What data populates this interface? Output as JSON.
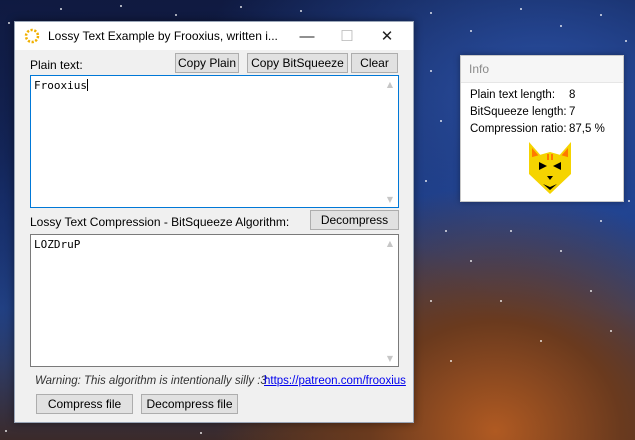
{
  "window": {
    "title": "Lossy Text Example by Frooxius, written i...",
    "minimize_glyph": "—",
    "maximize_glyph": "☐",
    "close_glyph": "✕"
  },
  "plain": {
    "label": "Plain text:",
    "copy_plain": "Copy Plain",
    "copy_bitsqueeze": "Copy BitSqueeze",
    "clear": "Clear",
    "value": "Frooxius"
  },
  "bitsqueeze": {
    "label": "Lossy Text Compression - BitSqueeze Algorithm:",
    "decompress": "Decompress",
    "value": "LOZDruP"
  },
  "footer": {
    "warning": "Warning: This algorithm is intentionally silly :3",
    "link": "https://patreon.com/frooxius",
    "compress_file": "Compress file",
    "decompress_file": "Decompress file"
  },
  "info": {
    "title": "Info",
    "plain_length_label": "Plain text length:",
    "plain_length_value": "8",
    "bits_length_label": "BitSqueeze length:",
    "bits_length_value": "7",
    "ratio_label": "Compression ratio:",
    "ratio_value": "87,5 %"
  },
  "icons": {
    "app": "loading-ring-icon",
    "mascot": "cat-face-icon",
    "scroll_up": "▲",
    "scroll_down": "▼"
  },
  "colors": {
    "accent": "#0078d7",
    "link": "#0000ee",
    "cat_yellow": "#f5d400"
  }
}
